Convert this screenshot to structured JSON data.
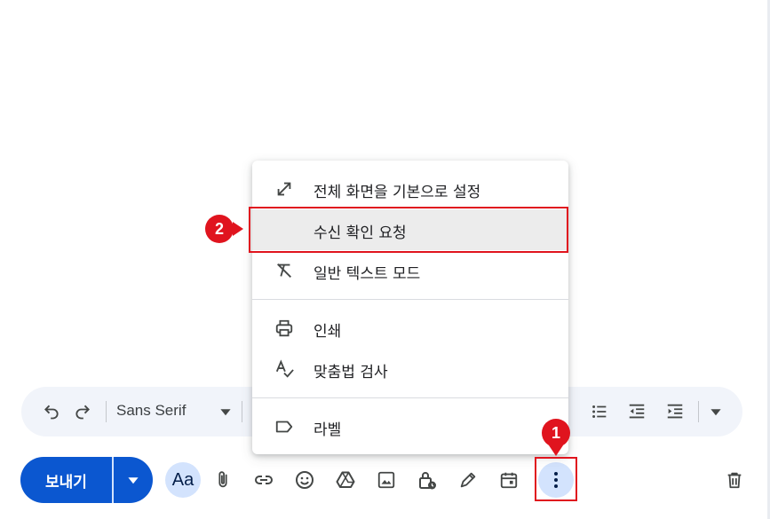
{
  "toolbar": {
    "font_name": "Sans Serif"
  },
  "actions": {
    "send_label": "보내기",
    "font_options_label": "Aa"
  },
  "menu": {
    "items": [
      {
        "label": "전체 화면을 기본으로 설정",
        "icon": "expand-arrows-icon"
      },
      {
        "label": "수신 확인 요청",
        "icon": ""
      },
      {
        "label": "일반 텍스트 모드",
        "icon": "clear-format-icon"
      },
      {
        "label": "인쇄",
        "icon": "print-icon"
      },
      {
        "label": "맞춤법 검사",
        "icon": "spellcheck-icon"
      },
      {
        "label": "라벨",
        "icon": "label-icon"
      }
    ]
  },
  "annotations": {
    "badge_1": "1",
    "badge_2": "2"
  },
  "colors": {
    "accent": "#0b57d0",
    "highlight": "#e0141e",
    "toolbar_bg": "#f1f4fa"
  }
}
